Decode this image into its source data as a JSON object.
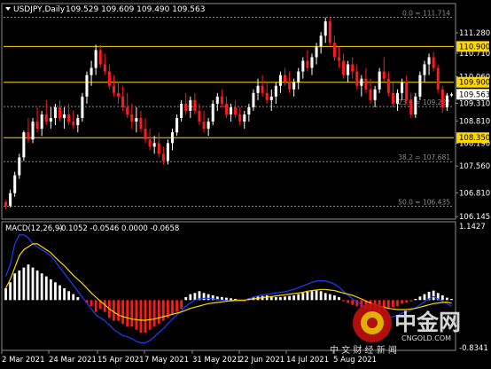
{
  "header": {
    "symbol_info": "USDJPY,Daily",
    "ohlc": "109.529 109.609 109.490 109.563"
  },
  "macd": {
    "label": "MACD(12,26,9)",
    "values": "-0.1052 -0.0546 0.0000 -0.0658",
    "axis_top": "1.1427",
    "axis_bottom": "-0.8341"
  },
  "watermark": {
    "brand": "中金网",
    "site": "CNGOLD.COM",
    "tagline": "中 文 财 经 新 闻",
    "logo_text": "CNGOLD"
  },
  "colors": {
    "background": "#000000",
    "bull_candle": "#ffffff",
    "bear_candle": "#ff1a1a",
    "resistance_line": "#ffd700",
    "fib_line": "#8c8c8c",
    "macd_signal": "#ffd700",
    "macd_main": "#1e3cff",
    "hist_pos": "#ffffff",
    "hist_neg": "#ff1a1a",
    "axis_text": "#ffffff",
    "price_tag_bg": "#ffd700",
    "current_tag_bg": "#ffffff"
  },
  "chart_data": {
    "type": "candlestick",
    "y_range": [
      106.1,
      112.05
    ],
    "x_labels": [
      "2 Mar 2021",
      "24 Mar 2021",
      "15 Apr 2021",
      "7 May 2021",
      "31 May 2021",
      "22 Jun 2021",
      "14 Jul 2021",
      "5 Aug 2021"
    ],
    "y_ticks": [
      {
        "value": 111.28,
        "label": "111.280"
      },
      {
        "value": 110.71,
        "label": "110.710"
      },
      {
        "value": 110.06,
        "label": "110.060"
      },
      {
        "value": 109.31,
        "label": "109.310"
      },
      {
        "value": 108.81,
        "label": "108.810"
      },
      {
        "value": 108.19,
        "label": "108.190"
      },
      {
        "value": 107.56,
        "label": "107.560"
      },
      {
        "value": 106.81,
        "label": "106.810"
      },
      {
        "value": 106.145,
        "label": "106.145"
      }
    ],
    "horizontal_levels": [
      {
        "value": 110.9,
        "label": "110.900",
        "kind": "resistance"
      },
      {
        "value": 109.9,
        "label": "109.900",
        "kind": "resistance"
      },
      {
        "value": 108.35,
        "label": "108.350",
        "kind": "support"
      }
    ],
    "fib_levels": [
      {
        "value": 111.714,
        "label": "0.0 = 111.714"
      },
      {
        "value": 109.222,
        "label": "23.6 = 109.222"
      },
      {
        "value": 107.681,
        "label": "38.2 = 107.681"
      },
      {
        "value": 106.435,
        "label": "50.0 = 106.435"
      }
    ],
    "current_price": {
      "value": 109.563,
      "label": "109.563"
    },
    "candles": [
      [
        106.55,
        106.6,
        106.35,
        106.45
      ],
      [
        106.45,
        106.9,
        106.4,
        106.8
      ],
      [
        106.8,
        107.4,
        106.7,
        107.3
      ],
      [
        107.3,
        107.9,
        107.2,
        107.8
      ],
      [
        107.8,
        108.55,
        107.7,
        108.5
      ],
      [
        108.5,
        108.9,
        108.2,
        108.3
      ],
      [
        108.3,
        108.9,
        108.2,
        108.8
      ],
      [
        108.8,
        109.2,
        108.5,
        108.6
      ],
      [
        108.6,
        109.1,
        108.4,
        109.0
      ],
      [
        109.0,
        109.4,
        108.7,
        108.8
      ],
      [
        108.8,
        109.2,
        108.6,
        108.9
      ],
      [
        108.9,
        109.3,
        108.7,
        109.2
      ],
      [
        109.2,
        109.4,
        108.8,
        108.9
      ],
      [
        108.9,
        109.2,
        108.6,
        109.0
      ],
      [
        109.0,
        109.3,
        108.7,
        108.8
      ],
      [
        108.8,
        109.1,
        108.6,
        108.7
      ],
      [
        108.7,
        109.0,
        108.5,
        108.9
      ],
      [
        108.9,
        109.6,
        108.8,
        109.5
      ],
      [
        109.5,
        110.2,
        109.3,
        110.1
      ],
      [
        110.1,
        110.5,
        109.8,
        110.3
      ],
      [
        110.3,
        110.95,
        110.1,
        110.8
      ],
      [
        110.8,
        110.95,
        110.3,
        110.4
      ],
      [
        110.4,
        110.7,
        110.1,
        110.2
      ],
      [
        110.2,
        110.4,
        109.7,
        109.8
      ],
      [
        109.8,
        110.1,
        109.5,
        109.6
      ],
      [
        109.6,
        109.9,
        109.3,
        109.5
      ],
      [
        109.5,
        109.8,
        109.1,
        109.2
      ],
      [
        109.2,
        109.6,
        108.9,
        109.0
      ],
      [
        109.0,
        109.3,
        108.6,
        108.8
      ],
      [
        108.8,
        109.2,
        108.5,
        108.9
      ],
      [
        108.9,
        109.1,
        108.5,
        108.6
      ],
      [
        108.6,
        108.9,
        108.2,
        108.3
      ],
      [
        108.3,
        108.6,
        108.0,
        108.1
      ],
      [
        108.1,
        108.4,
        107.9,
        108.2
      ],
      [
        108.2,
        108.5,
        107.8,
        107.9
      ],
      [
        107.9,
        108.1,
        107.6,
        107.7
      ],
      [
        107.7,
        108.3,
        107.6,
        108.2
      ],
      [
        108.2,
        108.6,
        108.0,
        108.5
      ],
      [
        108.5,
        109.0,
        108.4,
        108.9
      ],
      [
        108.9,
        109.4,
        108.8,
        109.3
      ],
      [
        109.3,
        109.6,
        109.0,
        109.1
      ],
      [
        109.1,
        109.5,
        108.9,
        109.4
      ],
      [
        109.4,
        109.6,
        109.0,
        109.1
      ],
      [
        109.1,
        109.3,
        108.7,
        108.8
      ],
      [
        108.8,
        109.1,
        108.5,
        108.6
      ],
      [
        108.6,
        108.9,
        108.4,
        108.8
      ],
      [
        108.8,
        109.4,
        108.7,
        109.3
      ],
      [
        109.3,
        109.6,
        109.1,
        109.5
      ],
      [
        109.5,
        109.7,
        109.2,
        109.3
      ],
      [
        109.3,
        109.5,
        108.9,
        109.0
      ],
      [
        109.0,
        109.3,
        108.8,
        109.2
      ],
      [
        109.2,
        109.4,
        108.9,
        109.0
      ],
      [
        109.0,
        109.2,
        108.7,
        108.8
      ],
      [
        108.8,
        109.1,
        108.6,
        109.0
      ],
      [
        109.0,
        109.3,
        108.8,
        109.2
      ],
      [
        109.2,
        109.7,
        109.1,
        109.6
      ],
      [
        109.6,
        110.0,
        109.4,
        109.8
      ],
      [
        109.8,
        110.1,
        109.5,
        109.6
      ],
      [
        109.6,
        109.9,
        109.3,
        109.4
      ],
      [
        109.4,
        109.7,
        109.1,
        109.5
      ],
      [
        109.5,
        109.9,
        109.3,
        109.8
      ],
      [
        109.8,
        110.2,
        109.6,
        110.1
      ],
      [
        110.1,
        110.3,
        109.8,
        109.9
      ],
      [
        109.9,
        110.2,
        109.6,
        109.7
      ],
      [
        109.7,
        110.0,
        109.5,
        109.9
      ],
      [
        109.9,
        110.3,
        109.7,
        110.2
      ],
      [
        110.2,
        110.6,
        110.0,
        110.5
      ],
      [
        110.5,
        110.8,
        110.2,
        110.3
      ],
      [
        110.3,
        110.7,
        110.1,
        110.6
      ],
      [
        110.6,
        111.0,
        110.4,
        110.9
      ],
      [
        110.9,
        111.3,
        110.7,
        111.2
      ],
      [
        111.2,
        111.71,
        111.0,
        111.6
      ],
      [
        111.6,
        111.7,
        110.9,
        111.0
      ],
      [
        111.0,
        111.2,
        110.5,
        110.6
      ],
      [
        110.6,
        110.9,
        110.3,
        110.5
      ],
      [
        110.5,
        110.7,
        110.0,
        110.1
      ],
      [
        110.1,
        110.5,
        109.9,
        110.4
      ],
      [
        110.4,
        110.6,
        110.0,
        110.2
      ],
      [
        110.2,
        110.4,
        109.7,
        109.8
      ],
      [
        109.8,
        110.1,
        109.5,
        110.0
      ],
      [
        110.0,
        110.3,
        109.6,
        109.7
      ],
      [
        109.7,
        110.0,
        109.3,
        109.4
      ],
      [
        109.4,
        109.8,
        109.2,
        109.7
      ],
      [
        109.7,
        110.3,
        109.6,
        110.2
      ],
      [
        110.2,
        110.6,
        109.9,
        110.0
      ],
      [
        110.0,
        110.2,
        109.5,
        109.6
      ],
      [
        109.6,
        109.9,
        109.2,
        109.3
      ],
      [
        109.3,
        109.7,
        109.1,
        109.6
      ],
      [
        109.6,
        110.0,
        109.4,
        109.9
      ],
      [
        109.9,
        110.1,
        109.3,
        109.4
      ],
      [
        109.4,
        109.6,
        108.9,
        109.0
      ],
      [
        109.0,
        109.6,
        108.9,
        109.5
      ],
      [
        109.5,
        110.2,
        109.4,
        110.1
      ],
      [
        110.1,
        110.5,
        109.9,
        110.4
      ],
      [
        110.4,
        110.7,
        110.1,
        110.6
      ],
      [
        110.6,
        110.75,
        110.2,
        110.3
      ],
      [
        110.3,
        110.4,
        109.6,
        109.7
      ],
      [
        109.7,
        109.8,
        109.05,
        109.2
      ],
      [
        109.2,
        109.6,
        109.1,
        109.53
      ],
      [
        109.53,
        109.61,
        109.49,
        109.563
      ]
    ],
    "macd_range": [
      -0.8341,
      1.1427
    ],
    "macd_hist": [
      0.2,
      0.3,
      0.45,
      0.5,
      0.55,
      0.6,
      0.55,
      0.5,
      0.45,
      0.4,
      0.35,
      0.3,
      0.25,
      0.2,
      0.15,
      0.1,
      0.05,
      0.0,
      -0.05,
      -0.1,
      -0.2,
      -0.15,
      -0.2,
      -0.3,
      -0.35,
      -0.35,
      -0.4,
      -0.45,
      -0.45,
      -0.5,
      -0.55,
      -0.55,
      -0.5,
      -0.45,
      -0.4,
      -0.35,
      -0.3,
      -0.25,
      -0.2,
      -0.15,
      0.05,
      0.1,
      0.12,
      0.15,
      0.12,
      0.1,
      0.08,
      0.06,
      0.05,
      0.04,
      0.03,
      0.02,
      -0.02,
      -0.03,
      0.03,
      0.05,
      0.06,
      0.07,
      0.08,
      0.06,
      0.05,
      0.05,
      0.06,
      0.07,
      0.08,
      0.1,
      0.12,
      0.14,
      0.15,
      0.16,
      0.15,
      0.12,
      0.1,
      0.08,
      0.05,
      -0.02,
      -0.05,
      -0.08,
      -0.1,
      -0.12,
      -0.14,
      -0.15,
      -0.18,
      -0.2,
      -0.18,
      -0.15,
      -0.12,
      -0.1,
      -0.06,
      -0.04,
      -0.02,
      0.02,
      0.06,
      0.1,
      0.14,
      0.16,
      0.12,
      0.08,
      0.04,
      0.02
    ],
    "macd_signal": [
      0.2,
      0.35,
      0.55,
      0.75,
      0.85,
      0.9,
      0.95,
      0.95,
      0.9,
      0.85,
      0.8,
      0.72,
      0.65,
      0.58,
      0.5,
      0.42,
      0.35,
      0.28,
      0.2,
      0.12,
      0.05,
      -0.02,
      -0.08,
      -0.15,
      -0.2,
      -0.25,
      -0.28,
      -0.3,
      -0.32,
      -0.33,
      -0.34,
      -0.34,
      -0.33,
      -0.32,
      -0.3,
      -0.28,
      -0.26,
      -0.24,
      -0.22,
      -0.2,
      -0.17,
      -0.14,
      -0.12,
      -0.1,
      -0.08,
      -0.06,
      -0.05,
      -0.04,
      -0.03,
      -0.02,
      -0.01,
      0.0,
      0.0,
      0.0,
      0.01,
      0.02,
      0.03,
      0.04,
      0.05,
      0.06,
      0.07,
      0.08,
      0.09,
      0.1,
      0.11,
      0.12,
      0.13,
      0.15,
      0.16,
      0.17,
      0.18,
      0.18,
      0.17,
      0.16,
      0.14,
      0.12,
      0.1,
      0.08,
      0.05,
      0.02,
      -0.02,
      -0.05,
      -0.08,
      -0.1,
      -0.12,
      -0.14,
      -0.15,
      -0.16,
      -0.16,
      -0.16,
      -0.15,
      -0.14,
      -0.12,
      -0.1,
      -0.08,
      -0.06,
      -0.05,
      -0.04,
      -0.035,
      -0.0546
    ],
    "macd_main": [
      0.4,
      0.6,
      0.95,
      1.1,
      1.1,
      1.05,
      0.95,
      0.9,
      0.85,
      0.8,
      0.75,
      0.65,
      0.55,
      0.45,
      0.35,
      0.25,
      0.15,
      0.05,
      -0.05,
      -0.15,
      -0.25,
      -0.3,
      -0.35,
      -0.42,
      -0.5,
      -0.55,
      -0.6,
      -0.62,
      -0.65,
      -0.7,
      -0.72,
      -0.72,
      -0.68,
      -0.62,
      -0.55,
      -0.48,
      -0.4,
      -0.32,
      -0.25,
      -0.18,
      -0.1,
      -0.05,
      0.0,
      0.02,
      0.03,
      0.03,
      0.02,
      0.01,
      0.0,
      -0.01,
      -0.02,
      -0.02,
      -0.02,
      -0.01,
      0.02,
      0.05,
      0.07,
      0.09,
      0.1,
      0.11,
      0.12,
      0.13,
      0.14,
      0.16,
      0.18,
      0.21,
      0.24,
      0.27,
      0.3,
      0.32,
      0.33,
      0.32,
      0.3,
      0.27,
      0.22,
      0.15,
      0.08,
      0.02,
      -0.03,
      -0.08,
      -0.13,
      -0.18,
      -0.22,
      -0.26,
      -0.3,
      -0.3,
      -0.28,
      -0.26,
      -0.22,
      -0.2,
      -0.17,
      -0.13,
      -0.08,
      -0.03,
      0.02,
      0.06,
      0.02,
      -0.02,
      -0.06,
      -0.1052
    ]
  }
}
